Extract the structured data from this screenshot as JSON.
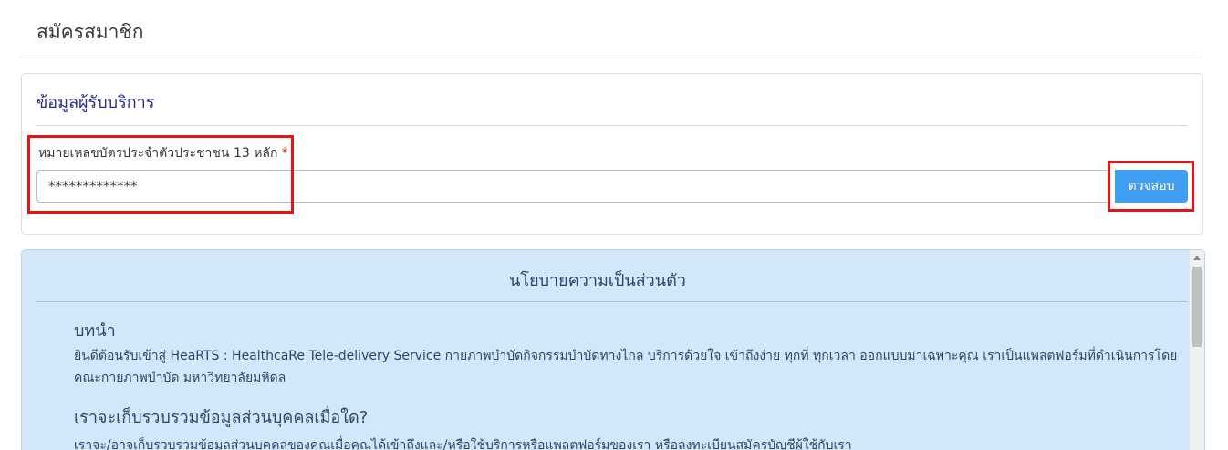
{
  "page": {
    "title": "สมัครสมาชิก"
  },
  "service_info": {
    "heading": "ข้อมูลผู้รับบริการ",
    "id_label": "หมายเหลขบัตรประจำตัวประชาชน 13 หลัก",
    "required_mark": "*",
    "id_value": "*************",
    "check_button_label": "ตวจสอบ"
  },
  "privacy_policy": {
    "title": "นโยบายความเป็นส่วนตัว",
    "sections": [
      {
        "heading": "บทนำ",
        "body": "ยินดีต้อนรับเข้าสู่ HeaRTS : HealthcaRe Tele-delivery Service กายภาพบำบัดกิจกรรมบำบัดทางไกล บริการด้วยใจ เข้าถึงง่าย ทุกที่ ทุกเวลา ออกแบบมาเฉพาะคุณ เราเป็นแพลตฟอร์มที่ดำเนินการโดย คณะกายภาพบำบัด มหาวิทยาลัยมหิดล"
      },
      {
        "heading": "เราจะเก็บรวบรวมข้อมูลส่วนบุคคลเมื่อใด?",
        "body": "เราจะ/อาจเก็บรวบรวมข้อมูลส่วนบุคคลของคุณเมื่อคุณได้เข้าถึงและ/หรือใช้บริการหรือแพลตฟอร์มของเรา หรือลงทะเบียนสมัครบัญชีผู้ใช้กับเรา"
      }
    ]
  },
  "colors": {
    "accent": "#3f9ef2",
    "heading_text": "#2a2a8c",
    "required": "#d9261c",
    "highlight": "#e01515",
    "policy_background": "#d3e7fb"
  }
}
